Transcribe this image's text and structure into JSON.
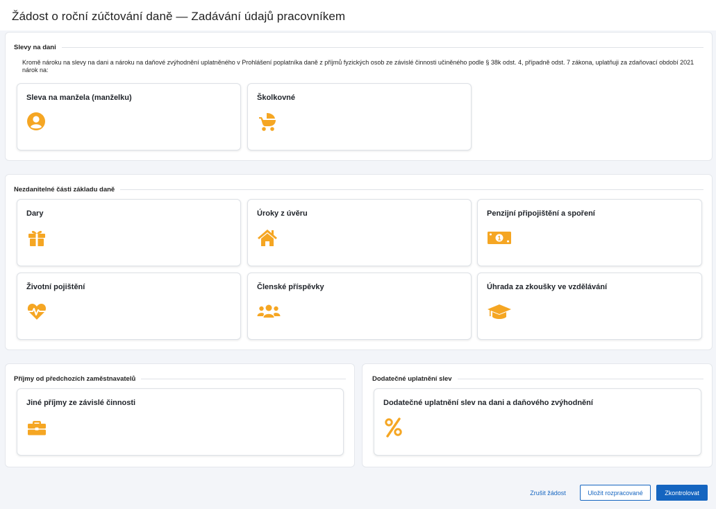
{
  "page": {
    "title": "Žádost o roční zúčtování daně — Zadávání údajů pracovníkem"
  },
  "colors": {
    "accent": "#f5a623",
    "primary": "#1565c0"
  },
  "sections": {
    "slevy": {
      "title": "Slevy na dani",
      "intro": "Kromě nároku na slevy na dani a nároku na daňové zvýhodnění uplatněného v Prohlášení poplatníka daně z příjmů fyzických osob ze závislé činnosti učiněného podle § 38k odst. 4, případně odst. 7 zákona, uplatňuji za zdaňovací období 2021 nárok na:",
      "cards": [
        {
          "label": "Sleva na manžela (manželku)",
          "icon": "user-circle-icon"
        },
        {
          "label": "Školkovné",
          "icon": "baby-carriage-icon"
        }
      ]
    },
    "nezdanitelne": {
      "title": "Nezdanitelné části základu daně",
      "cards": [
        {
          "label": "Dary",
          "icon": "gift-icon"
        },
        {
          "label": "Úroky z úvěru",
          "icon": "home-icon"
        },
        {
          "label": "Penzijní připojištění a spoření",
          "icon": "money-bill-icon"
        },
        {
          "label": "Životní pojištění",
          "icon": "heartbeat-icon"
        },
        {
          "label": "Členské příspěvky",
          "icon": "users-icon"
        },
        {
          "label": "Úhrada za zkoušky ve vzdělávání",
          "icon": "graduation-cap-icon"
        }
      ]
    },
    "prijmy": {
      "title": "Příjmy od předchozích zaměstnavatelů",
      "cards": [
        {
          "label": "Jiné příjmy ze závislé činnosti",
          "icon": "briefcase-icon"
        }
      ]
    },
    "dodatecne": {
      "title": "Dodatečné uplatnění slev",
      "cards": [
        {
          "label": "Dodatečné uplatnění slev na dani a daňového zvýhodnění",
          "icon": "percent-icon"
        }
      ]
    }
  },
  "footer": {
    "cancel_label": "Zrušit žádost",
    "save_label": "Uložit rozpracované",
    "check_label": "Zkontrolovat"
  }
}
